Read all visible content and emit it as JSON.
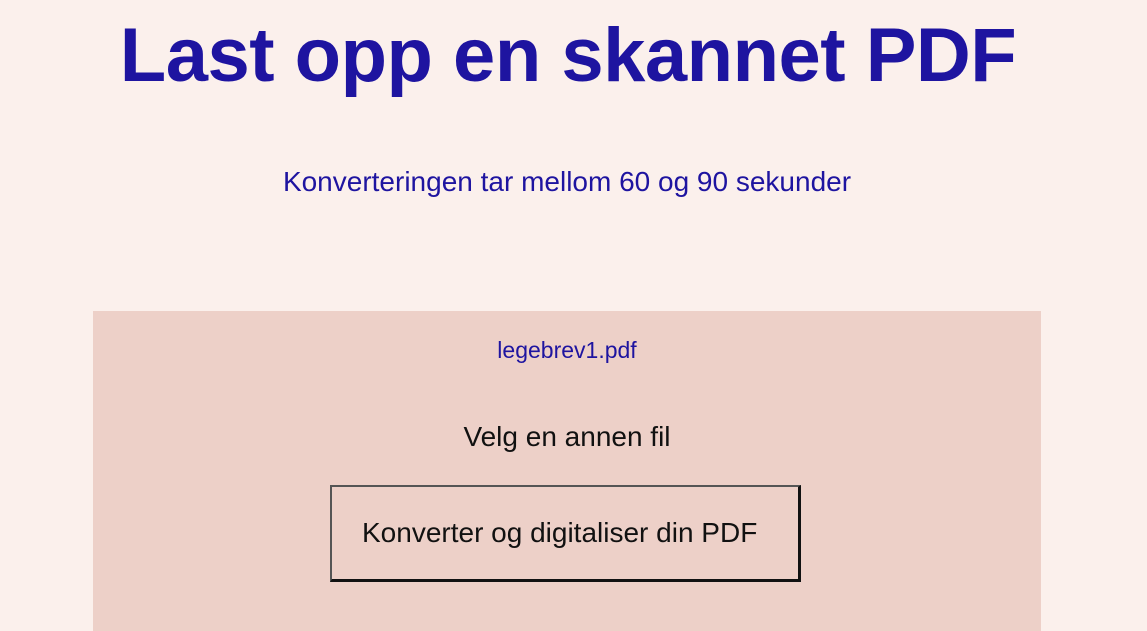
{
  "header": {
    "title": "Last opp en skannet PDF",
    "subtitle": "Konverteringen tar mellom 60 og 90 sekunder"
  },
  "upload": {
    "file_name": "legebrev1.pdf",
    "choose_other_label": "Velg en annen fil",
    "convert_button_label": "Konverter og digitaliser din PDF"
  },
  "colors": {
    "page_background": "#fbf0ec",
    "panel_background": "#edd0c8",
    "accent_text": "#1e14a0",
    "body_text": "#111111"
  }
}
